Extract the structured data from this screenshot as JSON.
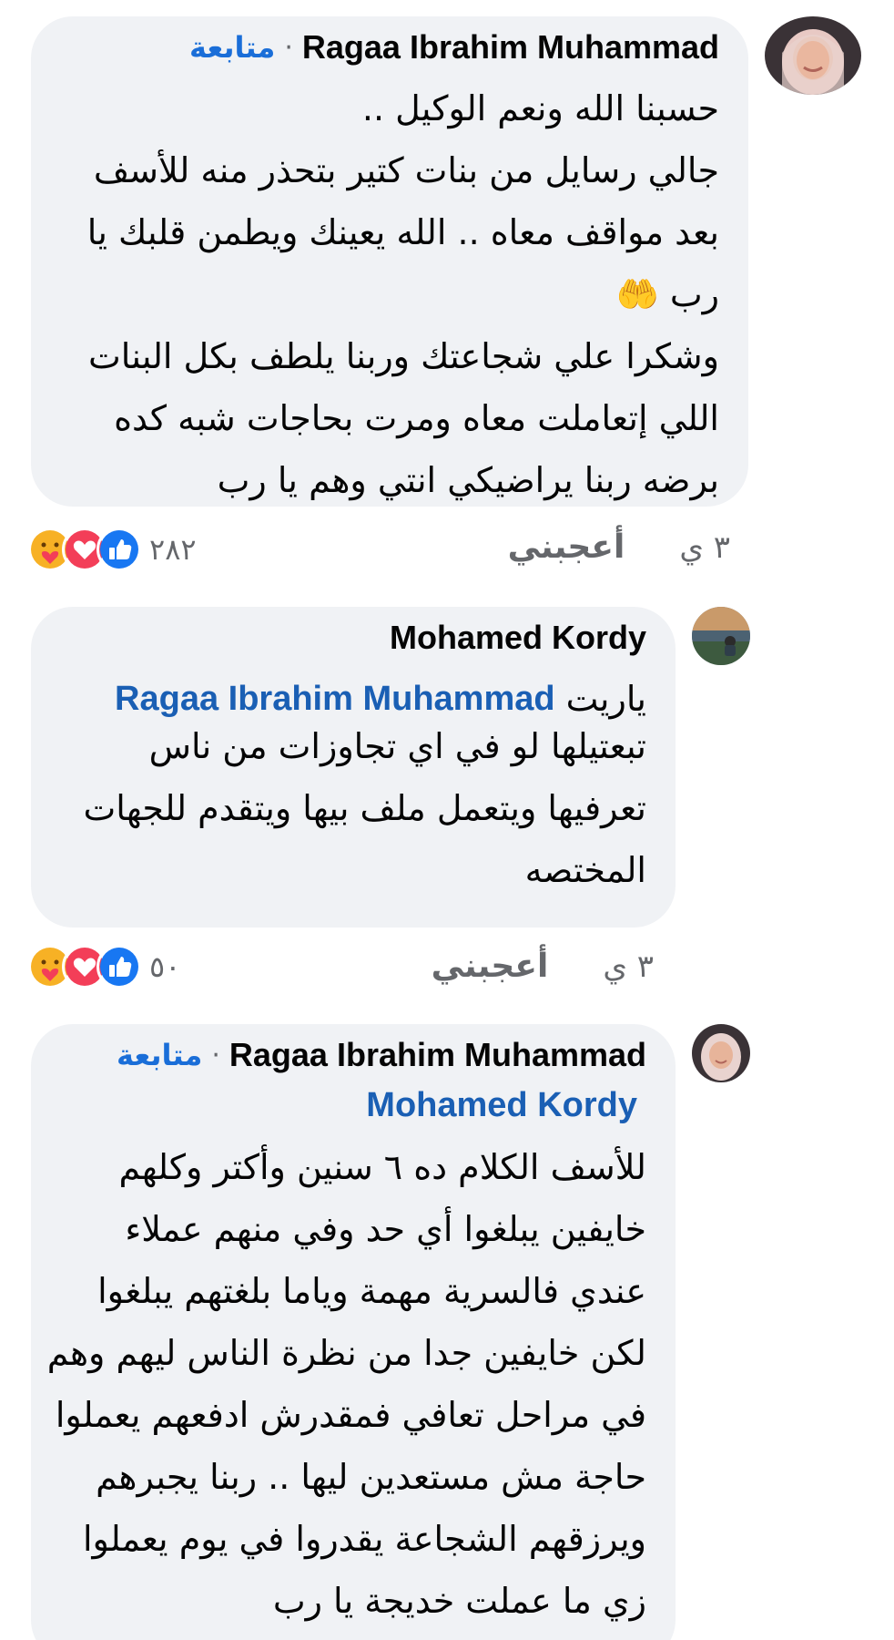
{
  "comments": [
    {
      "author": "Ragaa Ibrahim Muhammad",
      "separator": "·",
      "follow_label": "متابعة",
      "lines": [
        "حسبنا الله ونعم الوكيل ..",
        "جالي رسايل من بنات كتير بتحذر منه للأسف",
        "بعد مواقف معاه .. الله يعينك ويطمن قلبك يا",
        "رب 🤲",
        "وشكرا علي شجاعتك وربنا يلطف بكل البنات",
        "اللي إتعاملت معاه ومرت بحاجات شبه كده",
        "برضه ربنا يراضيكي انتي وهم يا رب"
      ],
      "time": "٣ ي",
      "like_label": "أعجبني",
      "reaction_count": "٢٨٢"
    },
    {
      "author": "Mohamed Kordy",
      "mention_prefix": "ياريت",
      "mention": "Ragaa Ibrahim Muhammad",
      "lines": [
        "تبعتيلها لو في اي تجاوزات من ناس",
        "تعرفيها ويتعمل ملف بيها ويتقدم للجهات",
        "المختصه"
      ],
      "time": "٣ ي",
      "like_label": "أعجبني",
      "reaction_count": "٥٠"
    },
    {
      "author": "Ragaa Ibrahim Muhammad",
      "separator": "·",
      "follow_label": "متابعة",
      "mention": "Mohamed Kordy",
      "lines": [
        "للأسف الكلام ده ٦ سنين وأكتر وكلهم",
        "خايفين يبلغوا أي حد وفي منهم عملاء",
        "عندي فالسرية مهمة وياما بلغتهم يبلغوا",
        "لكن خايفين جدا من نظرة الناس ليهم وهم",
        "في مراحل تعافي فمقدرش ادفعهم يعملوا",
        "حاجة مش مستعدين ليها .. ربنا يجبرهم",
        "ويرزقهم الشجاعة يقدروا في يوم يعملوا",
        "زي ما عملت خديجة يا رب"
      ]
    }
  ],
  "colors": {
    "bubble": "#f0f2f5",
    "link": "#1a6ed8",
    "text": "#050505",
    "meta": "#65676b",
    "like": "#1877f2",
    "love": "#f33e58",
    "care": "#f7b125"
  },
  "icons": {
    "reactions": [
      "care-icon",
      "love-icon",
      "like-icon"
    ]
  }
}
